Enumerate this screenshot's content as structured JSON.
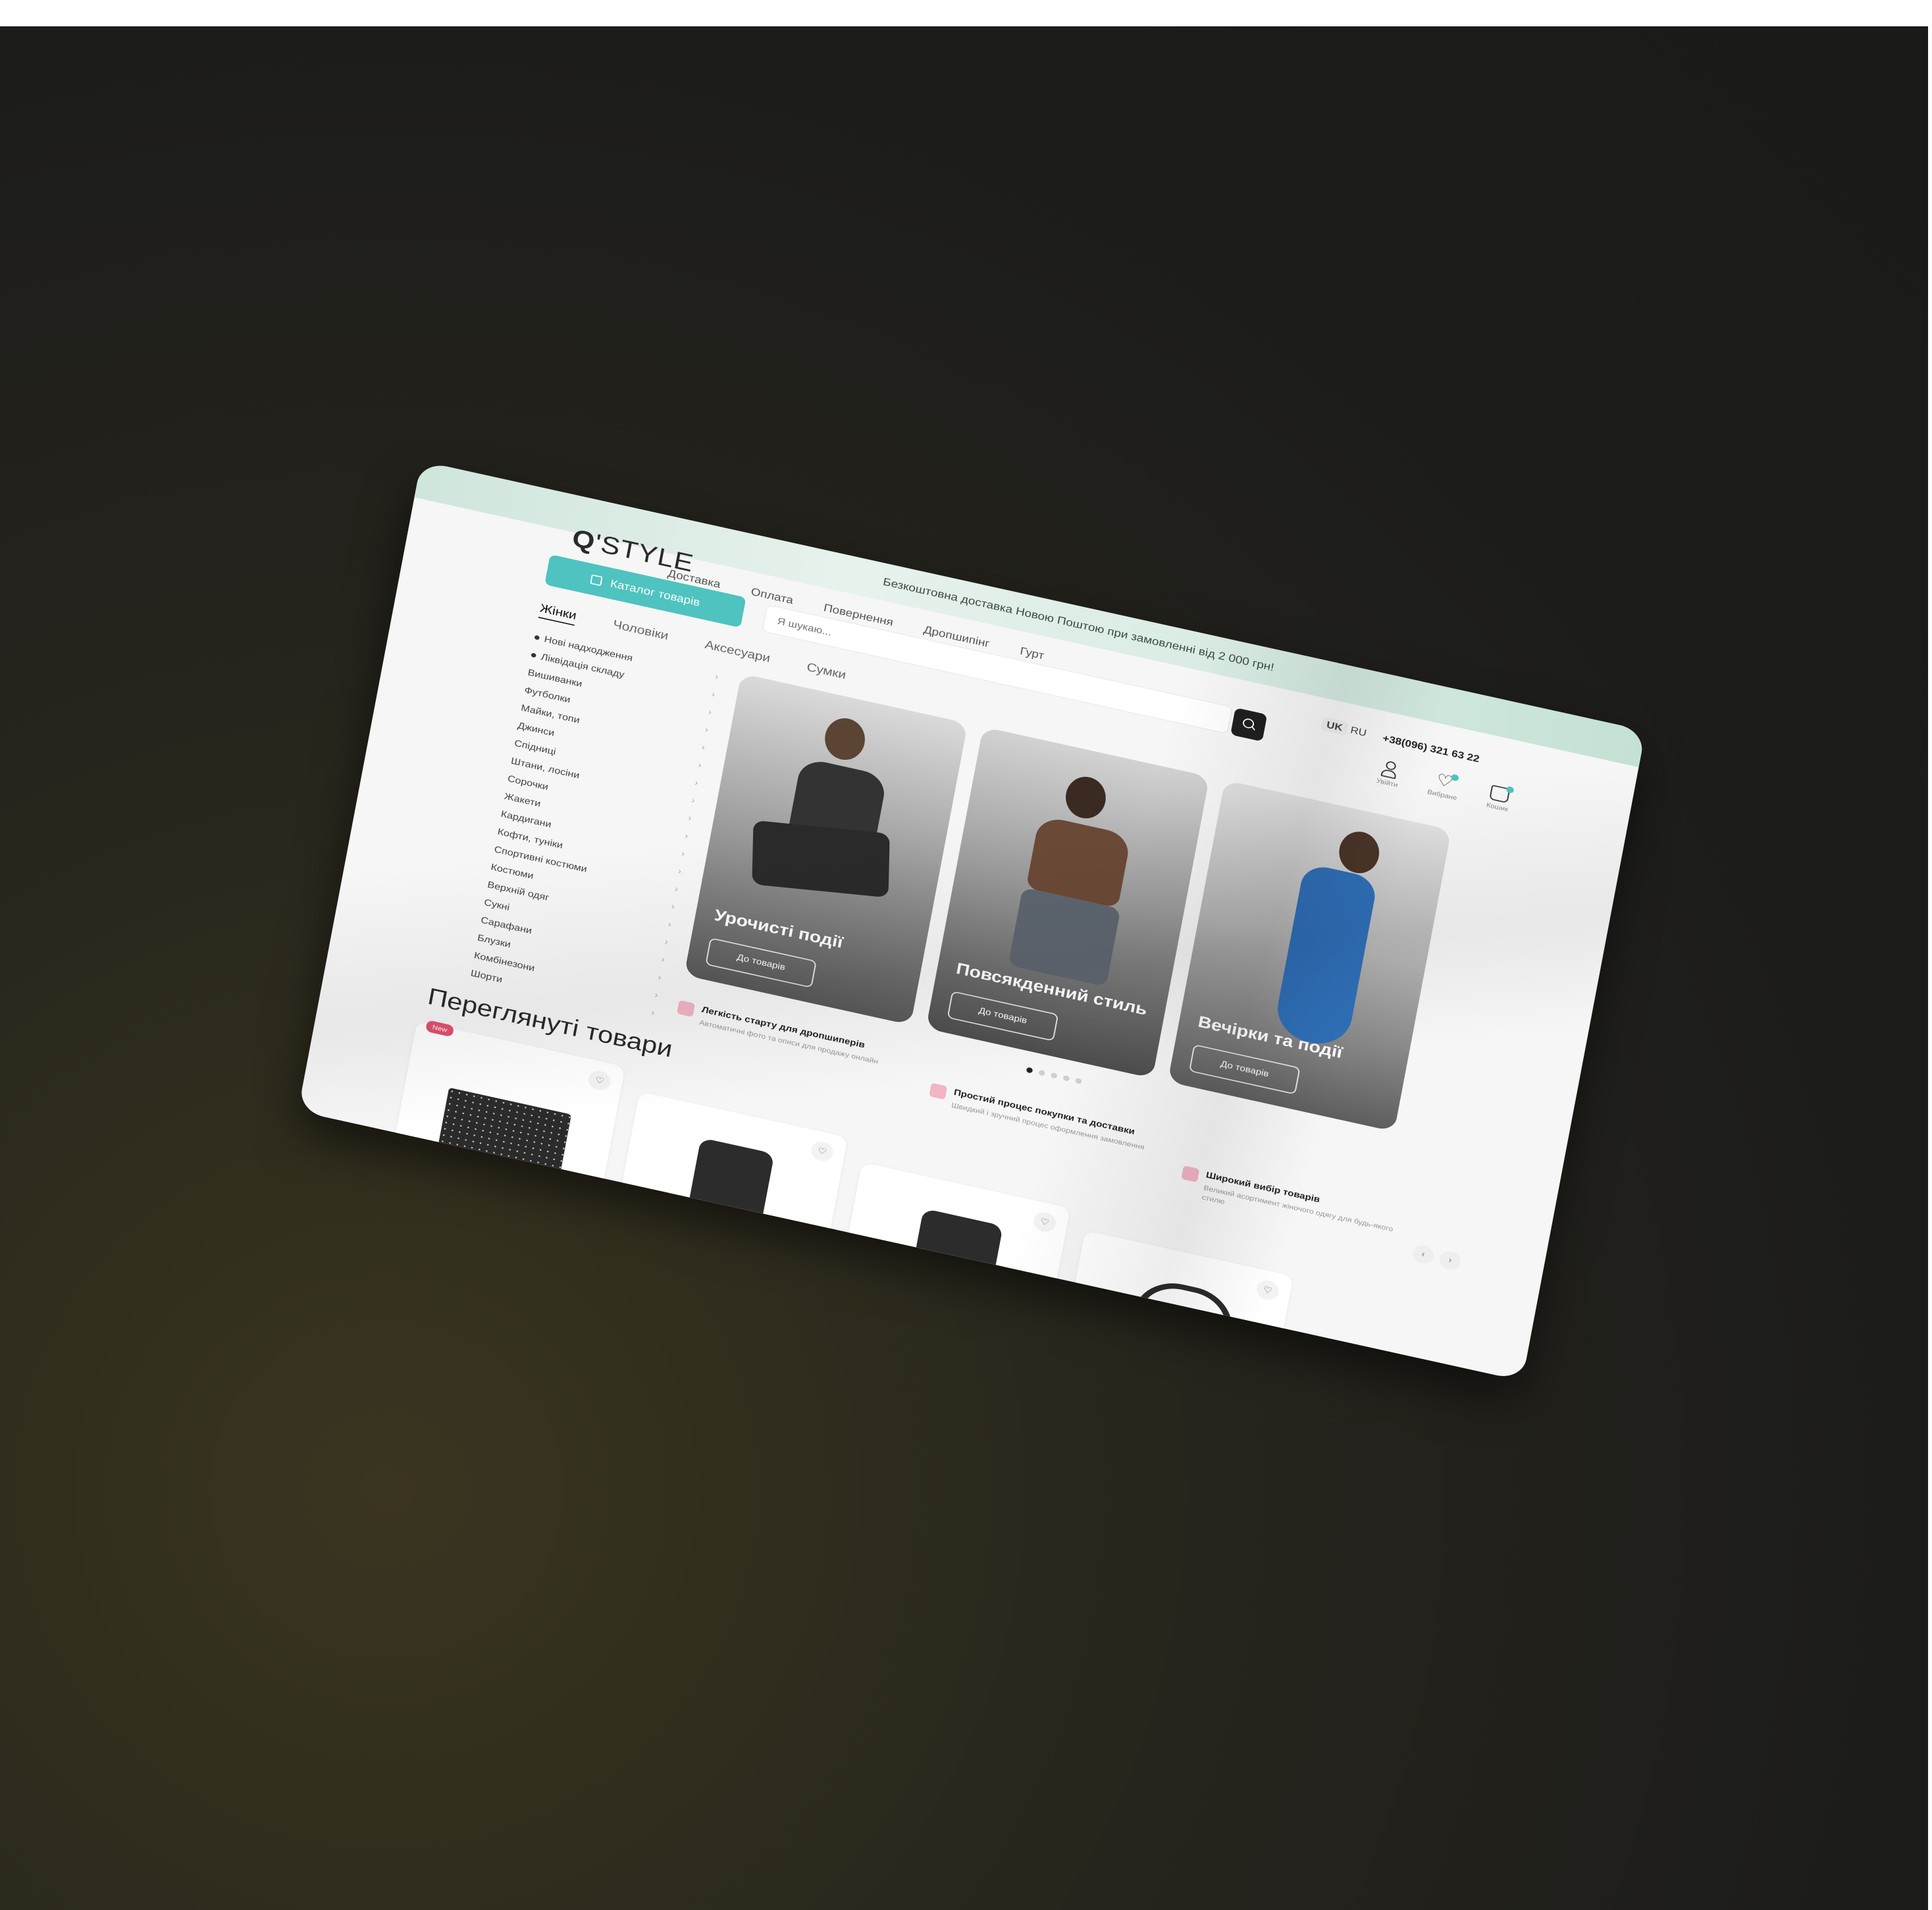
{
  "banner": {
    "text": "Безкоштовна доставка Новою Поштою при замовленні від 2 000 грн!"
  },
  "brand": {
    "logo_mark": "Q",
    "logo_text": "'STYLE"
  },
  "nav": [
    "Доставка",
    "Оплата",
    "Повернення",
    "Дропшипінг",
    "Гурт"
  ],
  "catalog_button": {
    "label": "Каталог товарів",
    "icon": "grid-icon"
  },
  "search": {
    "placeholder": "Я шукаю...",
    "icon": "search-icon"
  },
  "header": {
    "languages": [
      "UK",
      "RU"
    ],
    "active_language": "UK",
    "phone": "+38(096) 321 63 22",
    "icons": [
      {
        "name": "user-icon",
        "label": "Увійти"
      },
      {
        "name": "heart-icon",
        "label": "Вибране"
      },
      {
        "name": "bag-icon",
        "label": "Кошик"
      }
    ]
  },
  "tabs": [
    "Жінки",
    "Чоловіки",
    "Аксесуари",
    "Сумки"
  ],
  "active_tab": "Жінки",
  "sidebar": {
    "items": [
      {
        "label": "Нові надходження",
        "dot": true
      },
      {
        "label": "Ліквідація складу",
        "dot": true
      },
      {
        "label": "Вишиванки"
      },
      {
        "label": "Футболки"
      },
      {
        "label": "Майки, топи"
      },
      {
        "label": "Джинси"
      },
      {
        "label": "Спідниці"
      },
      {
        "label": "Штани, лосіни"
      },
      {
        "label": "Сорочки"
      },
      {
        "label": "Жакети"
      },
      {
        "label": "Кардигани"
      },
      {
        "label": "Кофти, туніки"
      },
      {
        "label": "Спортивні костюми"
      },
      {
        "label": "Костюми"
      },
      {
        "label": "Верхній одяг"
      },
      {
        "label": "Сукні"
      },
      {
        "label": "Сарафани"
      },
      {
        "label": "Блузки"
      },
      {
        "label": "Комбінезони"
      },
      {
        "label": "Шорти"
      }
    ]
  },
  "hero": {
    "cards": [
      {
        "title": "Урочисті події",
        "button": "До товарів"
      },
      {
        "title": "Повсякденний стиль",
        "button": "До товарів"
      },
      {
        "title": "Вечірки та події",
        "button": "До товарів"
      }
    ],
    "dots": 5,
    "active_dot": 0
  },
  "features": [
    {
      "title": "Легкість старту для дропшиперів",
      "desc": "Автоматичні фото та описи для продажу онлайн"
    },
    {
      "title": "Простий процес покупки та доставки",
      "desc": "Швидкий і зручний процес оформлення замовлення"
    },
    {
      "title": "Широкий вибір товарів",
      "desc": "Великий асортимент жіночого одягу для будь-якого стилю"
    }
  ],
  "viewed": {
    "title": "Переглянуті товари",
    "badge": "New",
    "pager": [
      "‹",
      "›"
    ]
  },
  "colors": {
    "accent": "#4ec3bf",
    "badge": "#e0516f",
    "banner": "#cfe6dc"
  }
}
